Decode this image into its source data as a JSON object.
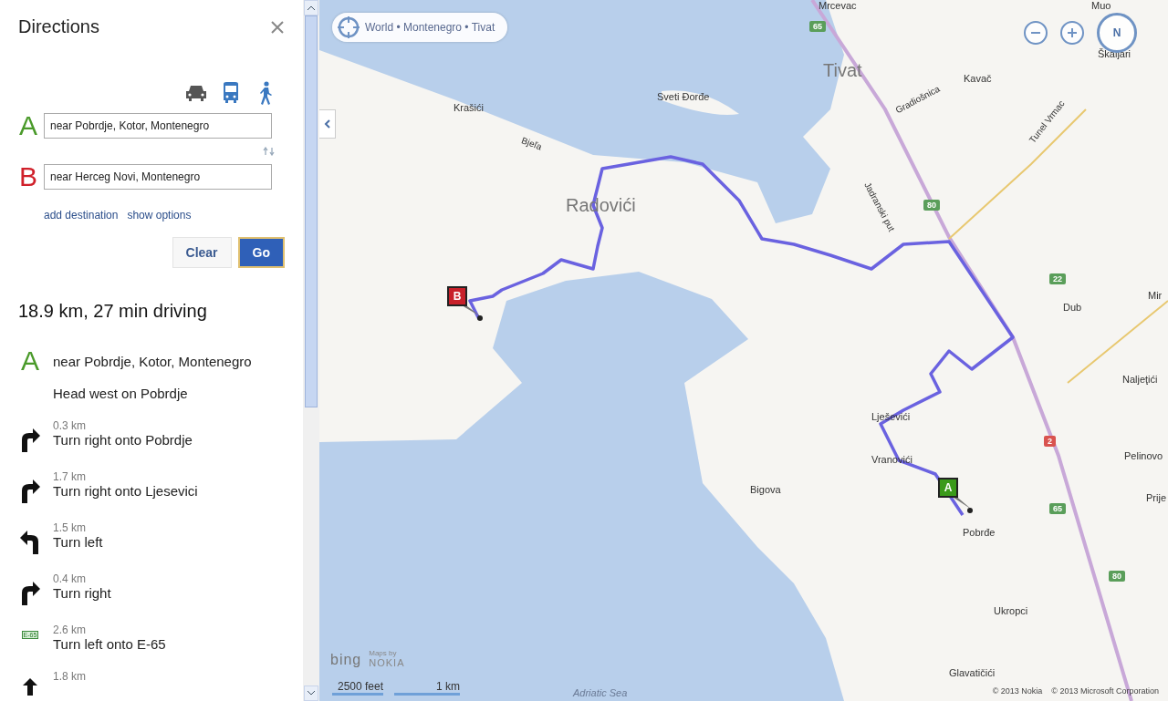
{
  "panel": {
    "title": "Directions",
    "modes": [
      {
        "kind": "car",
        "selected": true
      },
      {
        "kind": "bus",
        "selected": false
      },
      {
        "kind": "walk",
        "selected": false
      }
    ],
    "waypoints": [
      {
        "letter": "A",
        "value": "near Pobrdje, Kotor, Montenegro",
        "color": "#4a9a2a"
      },
      {
        "letter": "B",
        "value": "near Herceg Novi, Montenegro",
        "color": "#d0202a"
      }
    ],
    "links": [
      "add destination",
      "show options"
    ],
    "buttons": [
      {
        "label": "Clear",
        "kind": "secondary"
      },
      {
        "label": "Go",
        "kind": "primary"
      }
    ],
    "summary": "18.9 km, 27 min driving",
    "start": {
      "letter": "A",
      "address": "near Pobrdje, Kotor, Montenegro",
      "instruction": "Head west on Pobrdje"
    },
    "steps": [
      {
        "kind": "right",
        "distance": "0.3 km",
        "text": "Turn right onto Pobrdje"
      },
      {
        "kind": "right",
        "distance": "1.7 km",
        "text": "Turn right onto Ljesevici"
      },
      {
        "kind": "left",
        "distance": "1.5 km",
        "text": "Turn left"
      },
      {
        "kind": "right",
        "distance": "0.4 km",
        "text": "Turn right"
      },
      {
        "kind": "highway",
        "shield": "E-65",
        "distance": "2.6 km",
        "text": "Turn left onto E-65"
      },
      {
        "kind": "straight",
        "distance": "1.8 km"
      }
    ]
  },
  "map": {
    "breadcrumb": "World • Montenegro • Tivat",
    "compass": "N",
    "places": [
      {
        "name": "Mrcevac",
        "kind": "village"
      },
      {
        "name": "Muo",
        "kind": "village"
      },
      {
        "name": "Tivat",
        "kind": "town"
      },
      {
        "name": "Gradiošnica",
        "kind": "road"
      },
      {
        "name": "Kavač",
        "kind": "village"
      },
      {
        "name": "Škaljari",
        "kind": "village"
      },
      {
        "name": "Krašići",
        "kind": "village"
      },
      {
        "name": "Sveti Đorđe",
        "kind": "village"
      },
      {
        "name": "Bjeľa",
        "kind": "road"
      },
      {
        "name": "Jadranski put",
        "kind": "road"
      },
      {
        "name": "Tunel Vrmac",
        "kind": "road"
      },
      {
        "name": "Radovići",
        "kind": "town"
      },
      {
        "name": "Dub",
        "kind": "village"
      },
      {
        "name": "Mir",
        "kind": "village"
      },
      {
        "name": "Naljeţići",
        "kind": "village"
      },
      {
        "name": "Lješevići",
        "kind": "village"
      },
      {
        "name": "Vranovići",
        "kind": "village"
      },
      {
        "name": "Pelinovo",
        "kind": "village"
      },
      {
        "name": "Prije",
        "kind": "village"
      },
      {
        "name": "Bigova",
        "kind": "village"
      },
      {
        "name": "Pobrđe",
        "kind": "village"
      },
      {
        "name": "Ukropci",
        "kind": "village"
      },
      {
        "name": "Glavatičići",
        "kind": "village"
      },
      {
        "name": "Adriatic Sea",
        "kind": "sea"
      }
    ],
    "shields": [
      {
        "number": "65"
      },
      {
        "number": "80"
      },
      {
        "number": "22"
      },
      {
        "number": "2",
        "kind": "red"
      },
      {
        "number": "65"
      },
      {
        "number": "80"
      }
    ],
    "markers": [
      {
        "letter": "A",
        "color": "#3a9a1a"
      },
      {
        "letter": "B",
        "color": "#c8202a"
      }
    ],
    "logo": {
      "brand": "bing",
      "provider_caption": "Maps by",
      "provider": "NOKIA"
    },
    "scales": [
      "2500 feet",
      "1 km"
    ],
    "copyrights": [
      "© 2013 Nokia",
      "© 2013 Microsoft Corporation"
    ]
  }
}
